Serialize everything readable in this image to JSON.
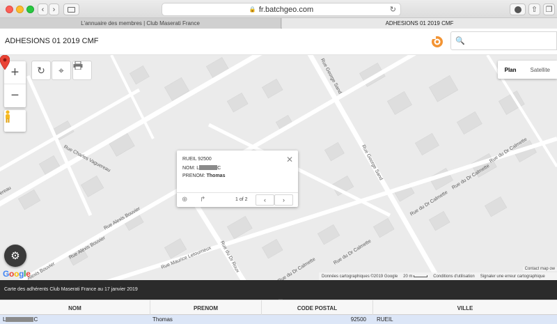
{
  "browser": {
    "url": "fr.batchgeo.com",
    "tabs": [
      {
        "label": "L'annuaire des membres | Club Maserati France"
      },
      {
        "label": "ADHESIONS 01 2019 CMF"
      }
    ]
  },
  "app": {
    "title": "ADHESIONS 01 2019 CMF",
    "brand_color": "#f39433"
  },
  "map": {
    "maptypes": {
      "plan": "Plan",
      "satellite": "Satellite"
    },
    "zoom_in": "+",
    "zoom_out": "−",
    "roads": [
      {
        "name": "Rue George Sand"
      },
      {
        "name": "Rue George Sand"
      },
      {
        "name": "Rue Charles Vaguereau"
      },
      {
        "name": "Rue Alexis Bouvier"
      },
      {
        "name": "Rue Alexis Bouvier"
      },
      {
        "name": "Alexis Bouvier"
      },
      {
        "name": "Rue Maurice Letourneux"
      },
      {
        "name": "Rue du Dr Roux"
      },
      {
        "name": "Rue du Dr Calmette"
      },
      {
        "name": "Rue du Dr Calmette"
      },
      {
        "name": "Rue du Dr Calmette"
      },
      {
        "name": "Rue du Dr Calmette"
      },
      {
        "name": "Rue du Dr Calmette"
      },
      {
        "name": "ereau"
      }
    ],
    "infowindow": {
      "line1": "RUEIL 92500",
      "nom_label": "NOM: ",
      "nom_prefix": "L",
      "nom_suffix": "C",
      "prenom_label": "PRENOM: ",
      "prenom_value": "Thomas",
      "pager": "1 of 2",
      "close": "✕"
    },
    "google": "Google",
    "attribution": {
      "data": "Données cartographiques ©2019 Google",
      "scale": "20 m",
      "terms": "Conditions d'utilisation",
      "report": "Signaler une erreur cartographique",
      "contact": "Contact map ow"
    }
  },
  "caption": "Carte des adhérents Club Maserati France au 17 janvier 2019",
  "table": {
    "columns": [
      "NOM",
      "PRENOM",
      "CODE POSTAL",
      "VILLE"
    ],
    "rows": [
      {
        "nom_prefix": "L",
        "nom_suffix": "C",
        "prenom": "Thomas",
        "code_postal": "92500",
        "ville": "RUEIL"
      }
    ]
  },
  "icons": {
    "reload": "refresh-icon",
    "locate": "crosshair-icon",
    "print": "print-icon",
    "settings": "gear-icon",
    "pegman": "pegman-icon",
    "pin": "map-pin-icon"
  }
}
